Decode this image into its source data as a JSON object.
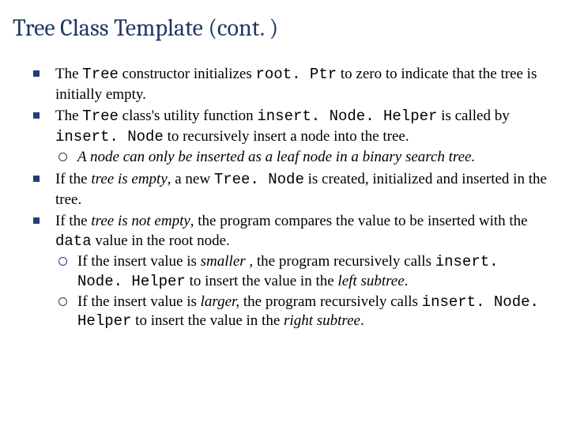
{
  "title": "Tree Class Template (cont. )",
  "bullets": [
    {
      "pre": "The ",
      "c1": "Tree",
      "mid1": " constructor initializes ",
      "c2": "root. Ptr",
      "post": " to zero to indicate that the tree is initially empty."
    },
    {
      "pre": "The ",
      "c1": "Tree",
      "mid1": " class's utility function ",
      "c2": "insert. Node. Helper",
      "mid2": " is called by ",
      "c3": "insert. Node",
      "post": " to recursively insert a node into the tree.",
      "sub": [
        {
          "ital": "A node can only be inserted as a leaf node in a binary search tree."
        }
      ]
    },
    {
      "pre": "If the ",
      "i1": "tree is empty",
      "mid1": ", a new ",
      "c1": "Tree. Node",
      "post": " is created, initialized and inserted in the tree."
    },
    {
      "pre": "If the ",
      "i1": "tree is not empty",
      "mid1": ", the program compares the value to be inserted with the ",
      "c1": "data",
      "post": " value in the root node.",
      "sub": [
        {
          "pre": "If the insert value is ",
          "i1": "smaller",
          "mid1": " , the program recursively calls ",
          "c1": "insert. Node. Helper",
          "mid2": " to insert the value in the ",
          "i2": "left subtree",
          "post": "."
        },
        {
          "pre": "If the insert value is ",
          "i1": "larger,",
          "mid1": " the program recursively calls ",
          "c1": "insert. Node. Helper",
          "mid2": " to insert the value in the ",
          "i2": "right subtree",
          "post": "."
        }
      ]
    }
  ]
}
